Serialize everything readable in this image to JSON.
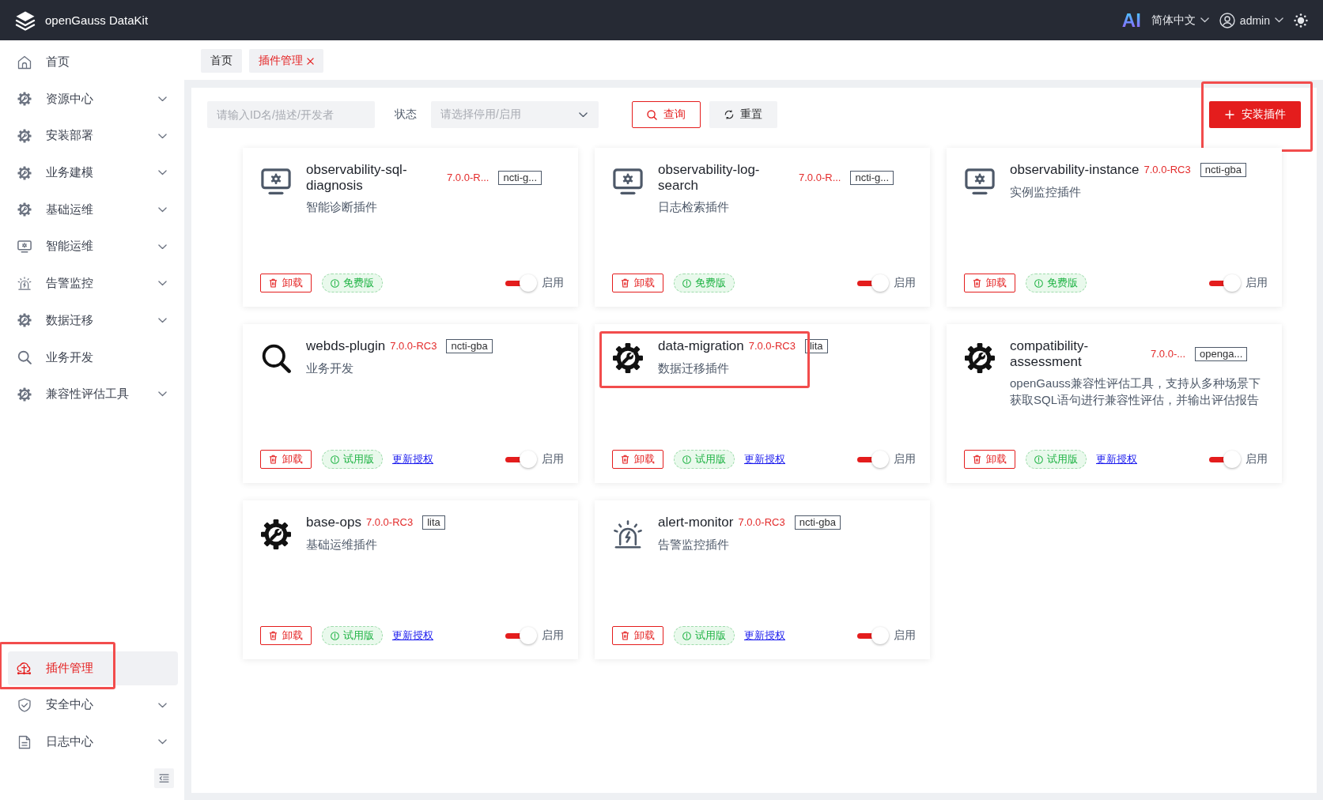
{
  "header": {
    "title": "openGauss DataKit",
    "ai_label": "AI",
    "language": "简体中文",
    "user": "admin"
  },
  "sidebar": {
    "items": [
      {
        "label": "首页",
        "selected": false,
        "highlighted": false
      },
      {
        "label": "资源中心",
        "selected": false,
        "expanded": false,
        "highlighted": false
      },
      {
        "label": "安装部署",
        "selected": false,
        "expanded": false,
        "highlighted": false
      },
      {
        "label": "业务建模",
        "selected": false,
        "expanded": false,
        "highlighted": false
      },
      {
        "label": "基础运维",
        "selected": false,
        "expanded": false,
        "highlighted": false
      },
      {
        "label": "智能运维",
        "selected": false,
        "expanded": false,
        "highlighted": false
      },
      {
        "label": "告警监控",
        "selected": false,
        "expanded": false,
        "highlighted": false
      },
      {
        "label": "数据迁移",
        "selected": false,
        "expanded": false,
        "highlighted": false
      },
      {
        "label": "业务开发",
        "selected": false,
        "highlighted": false
      },
      {
        "label": "兼容性评估工具",
        "selected": false,
        "expanded": false,
        "highlighted": false
      }
    ],
    "bottom_items": [
      {
        "label": "插件管理",
        "selected": true,
        "highlighted": true
      },
      {
        "label": "安全中心",
        "selected": false,
        "expanded": false,
        "highlighted": false
      },
      {
        "label": "日志中心",
        "selected": false,
        "expanded": false,
        "highlighted": false
      }
    ]
  },
  "tabs": [
    {
      "label": "首页",
      "selected": false,
      "closable": false
    },
    {
      "label": "插件管理",
      "selected": true,
      "closable": true
    }
  ],
  "filters": {
    "search": {
      "placeholder": "请输入ID名/描述/开发者"
    },
    "status": {
      "label": "状态",
      "placeholder": "请选择停用/启用"
    },
    "query_button": "查询",
    "reset_button": "重置"
  },
  "install_button": {
    "label": "安装插件",
    "highlighted": true
  },
  "plugins": [
    {
      "name": "observability-sql-diagnosis",
      "version": "7.0.0-R...",
      "tag": "ncti-g...",
      "description": "智能诊断插件",
      "uninstall": "卸载",
      "license": "免费版",
      "switch": {
        "on": true,
        "label": "启用"
      },
      "highlighted": false
    },
    {
      "name": "observability-log-search",
      "version": "7.0.0-R...",
      "tag": "ncti-g...",
      "description": "日志检索插件",
      "uninstall": "卸载",
      "license": "免费版",
      "switch": {
        "on": true,
        "label": "启用"
      },
      "highlighted": false
    },
    {
      "name": "observability-instance",
      "version": "7.0.0-RC3",
      "tag": "ncti-gba",
      "description": "实例监控插件",
      "uninstall": "卸载",
      "license": "免费版",
      "switch": {
        "on": true,
        "label": "启用"
      },
      "highlighted": false
    },
    {
      "name": "webds-plugin",
      "version": "7.0.0-RC3",
      "tag": "ncti-gba",
      "description": "业务开发",
      "uninstall": "卸载",
      "license": "试用版",
      "renew_link": "更新授权",
      "switch": {
        "on": true,
        "label": "启用"
      },
      "highlighted": false
    },
    {
      "name": "data-migration",
      "version": "7.0.0-RC3",
      "tag": "lita",
      "description": "数据迁移插件",
      "uninstall": "卸载",
      "license": "试用版",
      "renew_link": "更新授权",
      "switch": {
        "on": true,
        "label": "启用"
      },
      "highlighted": true
    },
    {
      "name": "compatibility-assessment",
      "version": "7.0.0-...",
      "tag": "openga...",
      "description": "openGauss兼容性评估工具，支持从多种场景下获取SQL语句进行兼容性评估，并输出评估报告",
      "uninstall": "卸载",
      "license": "试用版",
      "renew_link": "更新授权",
      "switch": {
        "on": true,
        "label": "启用"
      },
      "highlighted": false
    },
    {
      "name": "base-ops",
      "version": "7.0.0-RC3",
      "tag": "lita",
      "description": "基础运维插件",
      "uninstall": "卸载",
      "license": "试用版",
      "renew_link": "更新授权",
      "switch": {
        "on": true,
        "label": "启用"
      },
      "highlighted": false
    },
    {
      "name": "alert-monitor",
      "version": "7.0.0-RC3",
      "tag": "ncti-gba",
      "description": "告警监控插件",
      "uninstall": "卸载",
      "license": "试用版",
      "renew_link": "更新授权",
      "switch": {
        "on": true,
        "label": "启用"
      },
      "highlighted": false
    }
  ]
}
